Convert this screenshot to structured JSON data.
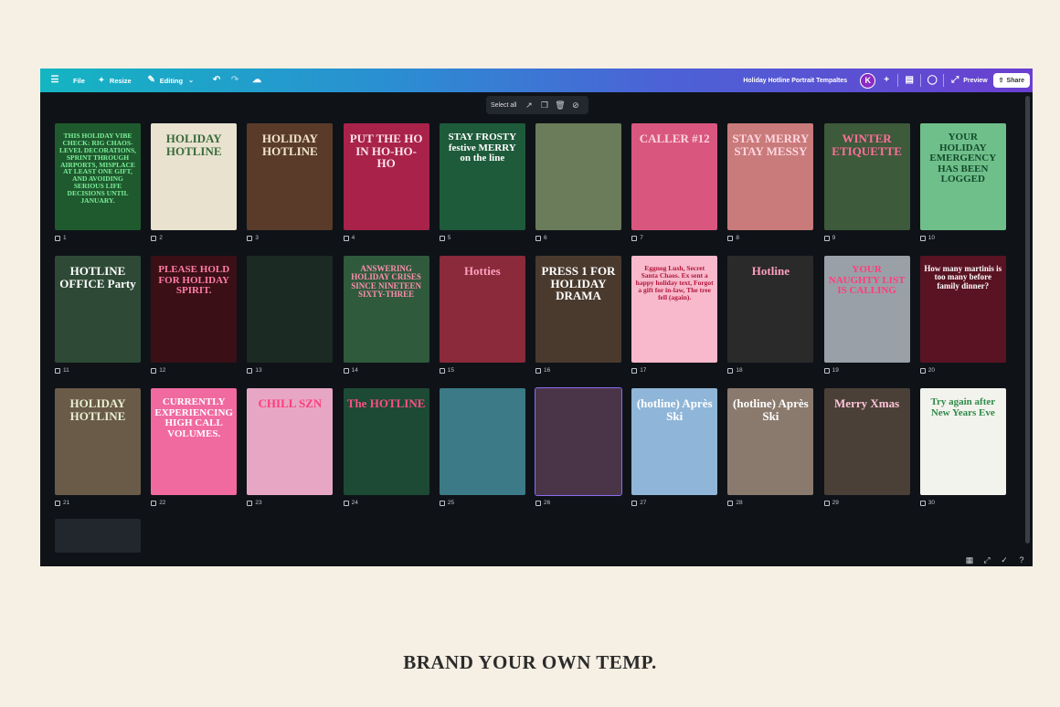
{
  "toolbar": {
    "menu_icon": "hamburger-icon",
    "file_label": "File",
    "resize_label": "Resize",
    "editing_label": "Editing",
    "doc_title": "Holiday Hotline Portrait Tempaltes",
    "avatar_initial": "K",
    "preview_label": "Preview",
    "share_label": "Share"
  },
  "selection_bar": {
    "select_all_label": "Select all"
  },
  "pages": [
    {
      "n": "1",
      "text": "THIS HOLIDAY VIBE CHECK: RIG CHAOS-LEVEL DECORATIONS, SPRINT THROUGH AIRPORTS, MISPLACE AT LEAST ONE GIFT, AND AVOIDING SERIOUS LIFE DECISIONS UNTIL JANUARY.",
      "bg": "#1f5a2e",
      "fg": "#7cf09a"
    },
    {
      "n": "2",
      "text": "HOLIDAY HOTLINE",
      "bg": "#e8e2cf",
      "fg": "#3a6b3a"
    },
    {
      "n": "3",
      "text": "HOLIDAY HOTLINE",
      "bg": "#5a3b2a",
      "fg": "#f3e6cc"
    },
    {
      "n": "4",
      "text": "PUT THE HO IN HO-HO-HO",
      "bg": "#a8224a",
      "fg": "#fde4ec"
    },
    {
      "n": "5",
      "text": "STAY FROSTY festive MERRY on the line",
      "bg": "#1e5b3b",
      "fg": "#ffffff"
    },
    {
      "n": "6",
      "text": "",
      "bg": "#6b7c5a",
      "fg": "#ffffff"
    },
    {
      "n": "7",
      "text": "CALLER #12",
      "bg": "#d9577f",
      "fg": "#fbd4e0"
    },
    {
      "n": "8",
      "text": "STAY MERRY STAY MESSY",
      "bg": "#c97a7a",
      "fg": "#ffd6df"
    },
    {
      "n": "9",
      "text": "WINTER ETIQUETTE",
      "bg": "#3d5a3a",
      "fg": "#ff6f9a"
    },
    {
      "n": "10",
      "text": "YOUR HOLIDAY EMERGENCY HAS BEEN LOGGED",
      "bg": "#6fbf8a",
      "fg": "#134a2b"
    },
    {
      "n": "11",
      "text": "HOTLINE OFFICE Party",
      "bg": "#2e4a36",
      "fg": "#ffffff"
    },
    {
      "n": "12",
      "text": "PLEASE HOLD FOR HOLIDAY SPIRIT.",
      "bg": "#3b0f16",
      "fg": "#ff7da6"
    },
    {
      "n": "13",
      "text": "",
      "bg": "#1b2a22",
      "fg": "#ff8fb0"
    },
    {
      "n": "14",
      "text": "ANSWERING HOLIDAY CRISES SINCE NINETEEN SIXTY-THREE",
      "bg": "#2f5a3c",
      "fg": "#ff8fb0"
    },
    {
      "n": "15",
      "text": "Hotties",
      "bg": "#8a2a3a",
      "fg": "#ff9fbf"
    },
    {
      "n": "16",
      "text": "PRESS 1 FOR HOLIDAY DRAMA",
      "bg": "#4a3a2e",
      "fg": "#ffffff"
    },
    {
      "n": "17",
      "text": "Eggnog Lush, Secret Santa Chaos. Ex sent a happy holiday text, Forgot a gift for in-law, The tree fell (again).",
      "bg": "#f7b9cb",
      "fg": "#b3163c"
    },
    {
      "n": "18",
      "text": "Hotline",
      "bg": "#2a2a2a",
      "fg": "#ff9fc0"
    },
    {
      "n": "19",
      "text": "YOUR NAUGHTY LIST IS CALLING",
      "bg": "#9aa0a8",
      "fg": "#ff3d7a"
    },
    {
      "n": "20",
      "text": "How many martinis is too many before family dinner?",
      "bg": "#5a1322",
      "fg": "#ffffff"
    },
    {
      "n": "21",
      "text": "HOLIDAY HOTLINE",
      "bg": "#6a5a48",
      "fg": "#e8f0d0"
    },
    {
      "n": "22",
      "text": "CURRENTLY EXPERIENCING HIGH CALL VOLUMES.",
      "bg": "#f06aa0",
      "fg": "#ffffff"
    },
    {
      "n": "23",
      "text": "CHILL SZN",
      "bg": "#e7a7c4",
      "fg": "#ff3d7a"
    },
    {
      "n": "24",
      "text": "The HOTLINE",
      "bg": "#1d4a34",
      "fg": "#ff4f88"
    },
    {
      "n": "25",
      "text": "",
      "bg": "#3b7a86",
      "fg": "#ff9fc0"
    },
    {
      "n": "26",
      "text": "",
      "bg": "#4a3448",
      "fg": "#ffd0e0"
    },
    {
      "n": "27",
      "text": "(hotline) Après Ski",
      "bg": "#8fb6d8",
      "fg": "#ffffff"
    },
    {
      "n": "28",
      "text": "(hotline) Après Ski",
      "bg": "#8a7a6e",
      "fg": "#ffffff"
    },
    {
      "n": "29",
      "text": "Merry Xmas",
      "bg": "#4a4038",
      "fg": "#ffc4d8"
    },
    {
      "n": "30",
      "text": "Try again after New Years Eve",
      "bg": "#f2f3ec",
      "fg": "#2f8a4a"
    }
  ],
  "caption": "BRAND YOUR OWN TEMP."
}
